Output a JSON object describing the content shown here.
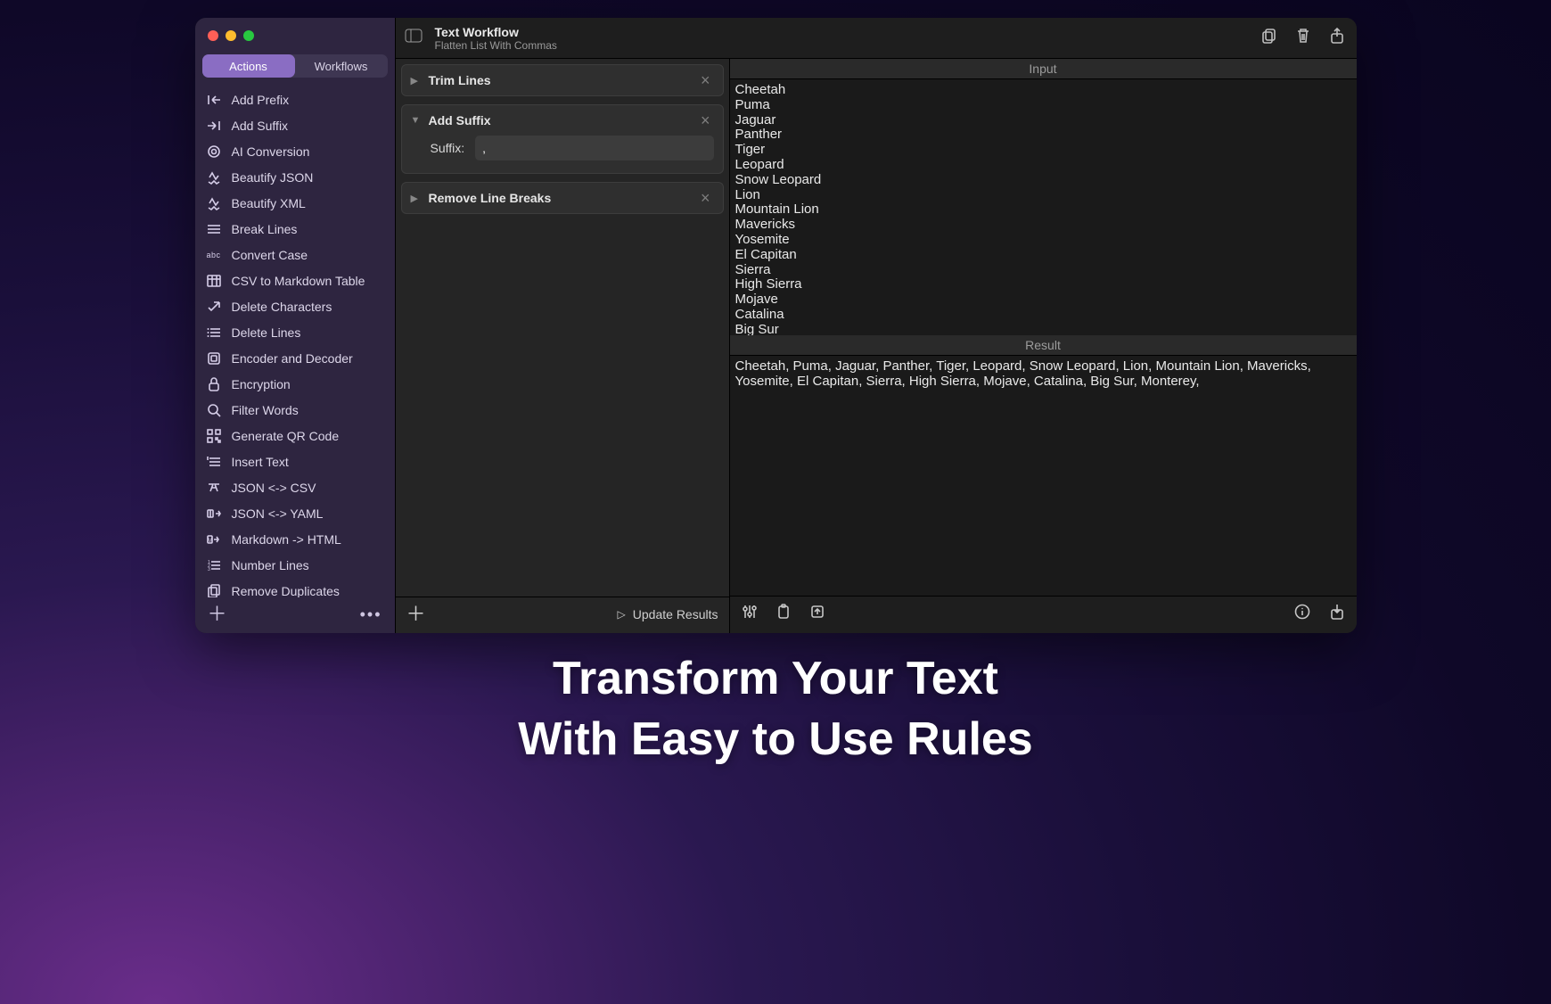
{
  "tabs": {
    "actions": "Actions",
    "workflows": "Workflows"
  },
  "sidebar_actions": [
    "Add Prefix",
    "Add Suffix",
    "AI Conversion",
    "Beautify JSON",
    "Beautify XML",
    "Break Lines",
    "Convert Case",
    "CSV to Markdown Table",
    "Delete Characters",
    "Delete Lines",
    "Encoder and Decoder",
    "Encryption",
    "Filter Words",
    "Generate QR Code",
    "Insert Text",
    "JSON <-> CSV",
    "JSON <-> YAML",
    "Markdown -> HTML",
    "Number Lines",
    "Remove Duplicates"
  ],
  "header": {
    "title": "Text Workflow",
    "subtitle": "Flatten List With Commas"
  },
  "steps": [
    {
      "name": "Trim Lines",
      "open": false
    },
    {
      "name": "Add Suffix",
      "open": true,
      "field_label": "Suffix:",
      "field_value": ","
    },
    {
      "name": "Remove Line Breaks",
      "open": false
    }
  ],
  "update_label": "Update Results",
  "io": {
    "input_label": "Input",
    "input_text": "Cheetah\nPuma\nJaguar\nPanther\nTiger\nLeopard\nSnow Leopard\nLion\nMountain Lion\nMavericks\nYosemite\nEl Capitan\nSierra\nHigh Sierra\nMojave\nCatalina\nBig Sur",
    "result_label": "Result",
    "result_text": "Cheetah, Puma, Jaguar, Panther, Tiger, Leopard, Snow Leopard, Lion, Mountain Lion, Mavericks, Yosemite, El Capitan, Sierra, High Sierra, Mojave, Catalina, Big Sur, Monterey,"
  },
  "tagline_line1": "Transform Your Text",
  "tagline_line2": "With Easy to Use Rules"
}
